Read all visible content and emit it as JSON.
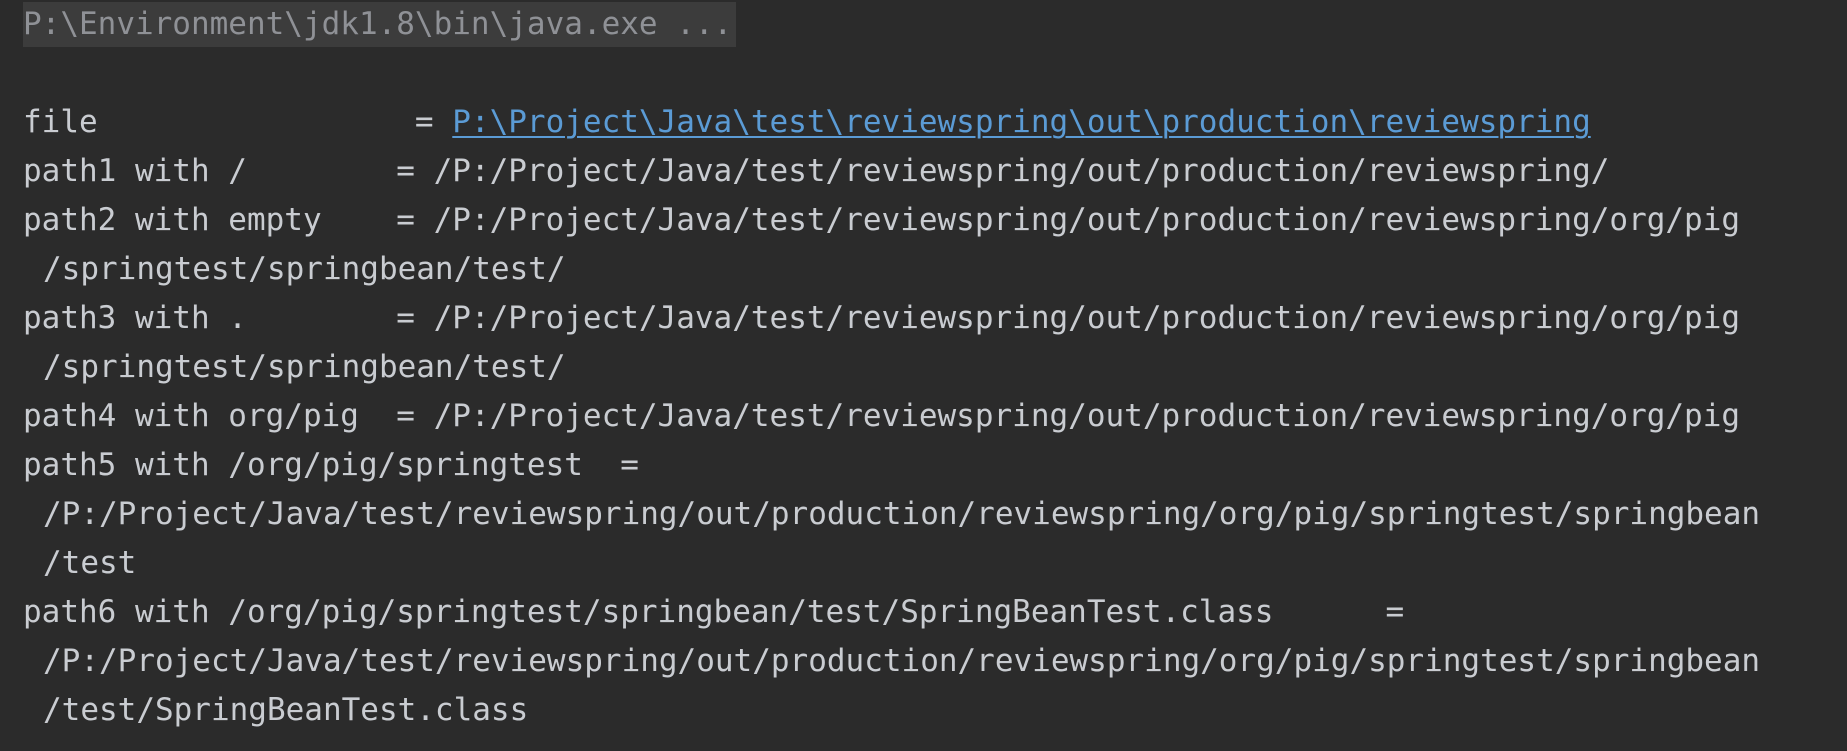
{
  "console": {
    "command": "P:\\Environment\\jdk1.8\\bin\\java.exe ...",
    "file_label": "file                 = ",
    "file_link": "P:\\Project\\Java\\test\\reviewspring\\out\\production\\reviewspring",
    "lines": [
      "path1 with /        = /P:/Project/Java/test/reviewspring/out/production/reviewspring/",
      "path2 with empty    = /P:/Project/Java/test/reviewspring/out/production/reviewspring/org/pig",
      "/springtest/springbean/test/",
      "path3 with .        = /P:/Project/Java/test/reviewspring/out/production/reviewspring/org/pig",
      "/springtest/springbean/test/",
      "path4 with org/pig  = /P:/Project/Java/test/reviewspring/out/production/reviewspring/org/pig",
      "path5 with /org/pig/springtest  =",
      "/P:/Project/Java/test/reviewspring/out/production/reviewspring/org/pig/springtest/springbean",
      "/test",
      "path6 with /org/pig/springtest/springbean/test/SpringBeanTest.class      =",
      "/P:/Project/Java/test/reviewspring/out/production/reviewspring/org/pig/springtest/springbean",
      "/test/SpringBeanTest.class"
    ]
  }
}
